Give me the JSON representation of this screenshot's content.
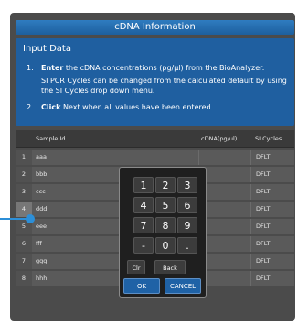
{
  "window": {
    "title": "cDNA Information"
  },
  "info": {
    "heading": "Input Data",
    "step1_num": "1.",
    "step1_bold": "Enter",
    "step1_text": " the cDNA concentrations (pg/µl) from the BioAnalyzer.",
    "step1_sub": "SI PCR Cycles can be changed from the calculated default by using the SI Cycles drop down menu.",
    "step2_num": "2.",
    "step2_bold": "Click",
    "step2_text": " Next when all values have been entered."
  },
  "table": {
    "headers": {
      "sample_id": "Sample Id",
      "conc": "cDNA(pg/ul)",
      "si": "SI Cycles"
    },
    "rows": [
      {
        "num": "1",
        "id": "aaa",
        "si": "DFLT"
      },
      {
        "num": "2",
        "id": "bbb",
        "si": "DFLT"
      },
      {
        "num": "3",
        "id": "ccc",
        "si": "DFLT"
      },
      {
        "num": "4",
        "id": "ddd",
        "si": "DFLT"
      },
      {
        "num": "5",
        "id": "eee",
        "si": "DFLT"
      },
      {
        "num": "6",
        "id": "fff",
        "si": "DFLT"
      },
      {
        "num": "7",
        "id": "ggg",
        "si": "DFLT"
      },
      {
        "num": "8",
        "id": "hhh",
        "si": "DFLT"
      }
    ]
  },
  "keypad": {
    "keys": [
      "1",
      "2",
      "3",
      "4",
      "5",
      "6",
      "7",
      "8",
      "9",
      "-",
      "0",
      "."
    ],
    "clr": "Clr",
    "back": "Back",
    "ok": "OK",
    "cancel": "CANCEL"
  },
  "colors": {
    "panel": "#4b4b4b",
    "accent": "#1f5fa0",
    "pointer": "#2c8fd8"
  }
}
